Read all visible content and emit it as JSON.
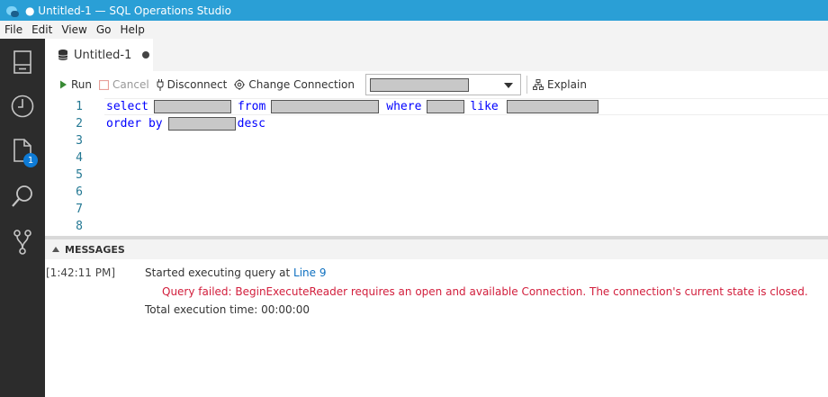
{
  "window": {
    "title": "● Untitled-1 — SQL Operations Studio"
  },
  "menu": {
    "items": [
      "File",
      "Edit",
      "View",
      "Go",
      "Help"
    ]
  },
  "activity": {
    "badge_count": "1"
  },
  "tab": {
    "label": "Untitled-1"
  },
  "toolbar": {
    "run_label": "Run",
    "cancel_label": "Cancel",
    "disconnect_label": "Disconnect",
    "change_connection_label": "Change Connection",
    "explain_label": "Explain"
  },
  "editor": {
    "line_numbers": [
      "1",
      "2",
      "3",
      "4",
      "5",
      "6",
      "7",
      "8"
    ],
    "line1": {
      "kw_select": "select",
      "kw_from": "from",
      "kw_where": "where",
      "kw_like": "like"
    },
    "line2": {
      "kw_order_by": "order by",
      "kw_desc": "desc"
    }
  },
  "panel": {
    "title": "MESSAGES",
    "timestamp": "[1:42:11 PM]",
    "started_text": "Started executing query at ",
    "started_link": "Line 9",
    "error_text": "Query failed: BeginExecuteReader requires an open and available Connection. The connection's current state is closed.",
    "total_text": "Total execution time: 00:00:00"
  },
  "colors": {
    "titlebar": "#2a9fd6",
    "activitybar": "#2c2c2c",
    "keyword": "#0000ff",
    "line_number": "#237893",
    "error": "#d21e3c",
    "link": "#0e70c0",
    "badge": "#0e7bd6"
  }
}
